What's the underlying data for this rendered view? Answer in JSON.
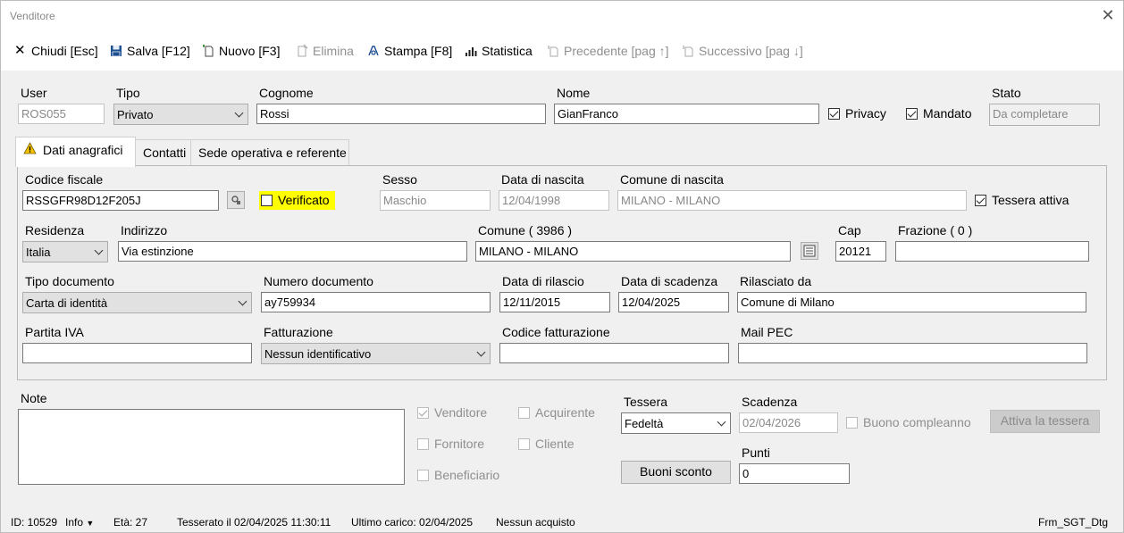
{
  "window": {
    "title": "Venditore"
  },
  "toolbar": {
    "close": "Chiudi [Esc]",
    "save": "Salva [F12]",
    "new": "Nuovo [F3]",
    "delete": "Elimina",
    "print": "Stampa [F8]",
    "stats": "Statistica",
    "prev": "Precedente [pag ↑]",
    "next": "Successivo [pag ↓]"
  },
  "header": {
    "user_label": "User",
    "user_value": "ROS055",
    "tipo_label": "Tipo",
    "tipo_value": "Privato",
    "cognome_label": "Cognome",
    "cognome_value": "Rossi",
    "nome_label": "Nome",
    "nome_value": "GianFranco",
    "privacy_label": "Privacy",
    "privacy_checked": true,
    "mandato_label": "Mandato",
    "mandato_checked": true,
    "stato_label": "Stato",
    "stato_value": "Da completare"
  },
  "tabs": [
    {
      "label": "Dati anagrafici",
      "active": true,
      "icon": "warning-icon"
    },
    {
      "label": "Contatti",
      "active": false
    },
    {
      "label": "Sede operativa e referente",
      "active": false
    }
  ],
  "anagrafici": {
    "codice_fiscale_label": "Codice fiscale",
    "codice_fiscale_value": "RSSGFR98D12F205J",
    "verificato_label": "Verificato",
    "verificato_checked": false,
    "sesso_label": "Sesso",
    "sesso_value": "Maschio",
    "data_nascita_label": "Data di nascita",
    "data_nascita_value": "12/04/1998",
    "comune_nascita_label": "Comune di nascita",
    "comune_nascita_value": "MILANO - MILANO",
    "tessera_attiva_label": "Tessera attiva",
    "tessera_attiva_checked": true,
    "residenza_label": "Residenza",
    "residenza_value": "Italia",
    "indirizzo_label": "Indirizzo",
    "indirizzo_value": "Via estinzione",
    "comune_label": "Comune ( 3986 )",
    "comune_value": "MILANO - MILANO",
    "cap_label": "Cap",
    "cap_value": "20121",
    "frazione_label": "Frazione ( 0 )",
    "frazione_value": "",
    "tipo_doc_label": "Tipo documento",
    "tipo_doc_value": "Carta di identità",
    "num_doc_label": "Numero documento",
    "num_doc_value": "ay759934",
    "data_rilascio_label": "Data di rilascio",
    "data_rilascio_value": "12/11/2015",
    "data_scadenza_label": "Data di scadenza",
    "data_scadenza_value": "12/04/2025",
    "rilasciato_label": "Rilasciato da",
    "rilasciato_value": "Comune di Milano",
    "piva_label": "Partita IVA",
    "piva_value": "",
    "fatturazione_label": "Fatturazione",
    "fatturazione_value": "Nessun identificativo",
    "codice_fatt_label": "Codice fatturazione",
    "codice_fatt_value": "",
    "pec_label": "Mail PEC",
    "pec_value": ""
  },
  "bottom": {
    "note_label": "Note",
    "note_value": "",
    "venditore_label": "Venditore",
    "venditore_checked": true,
    "acquirente_label": "Acquirente",
    "acquirente_checked": false,
    "fornitore_label": "Fornitore",
    "fornitore_checked": false,
    "cliente_label": "Cliente",
    "cliente_checked": false,
    "beneficiario_label": "Beneficiario",
    "beneficiario_checked": false,
    "tessera_label": "Tessera",
    "tessera_value": "Fedeltà",
    "scadenza_label": "Scadenza",
    "scadenza_value": "02/04/2026",
    "buono_label": "Buono compleanno",
    "buono_checked": false,
    "attiva_button": "Attiva la tessera",
    "buoni_button": "Buoni sconto",
    "punti_label": "Punti",
    "punti_value": "0"
  },
  "status": {
    "id": "ID: 10529",
    "info": "Info",
    "eta": "Età: 27",
    "tesserato": "Tesserato il 02/04/2025 11:30:11",
    "ultimo_carico": "Ultimo carico: 02/04/2025",
    "acquisti": "Nessun acquisto",
    "form_name": "Frm_SGT_Dtg"
  },
  "colors": {
    "highlight_yellow": "#ffff00",
    "window_bg": "#f0f0f0"
  }
}
